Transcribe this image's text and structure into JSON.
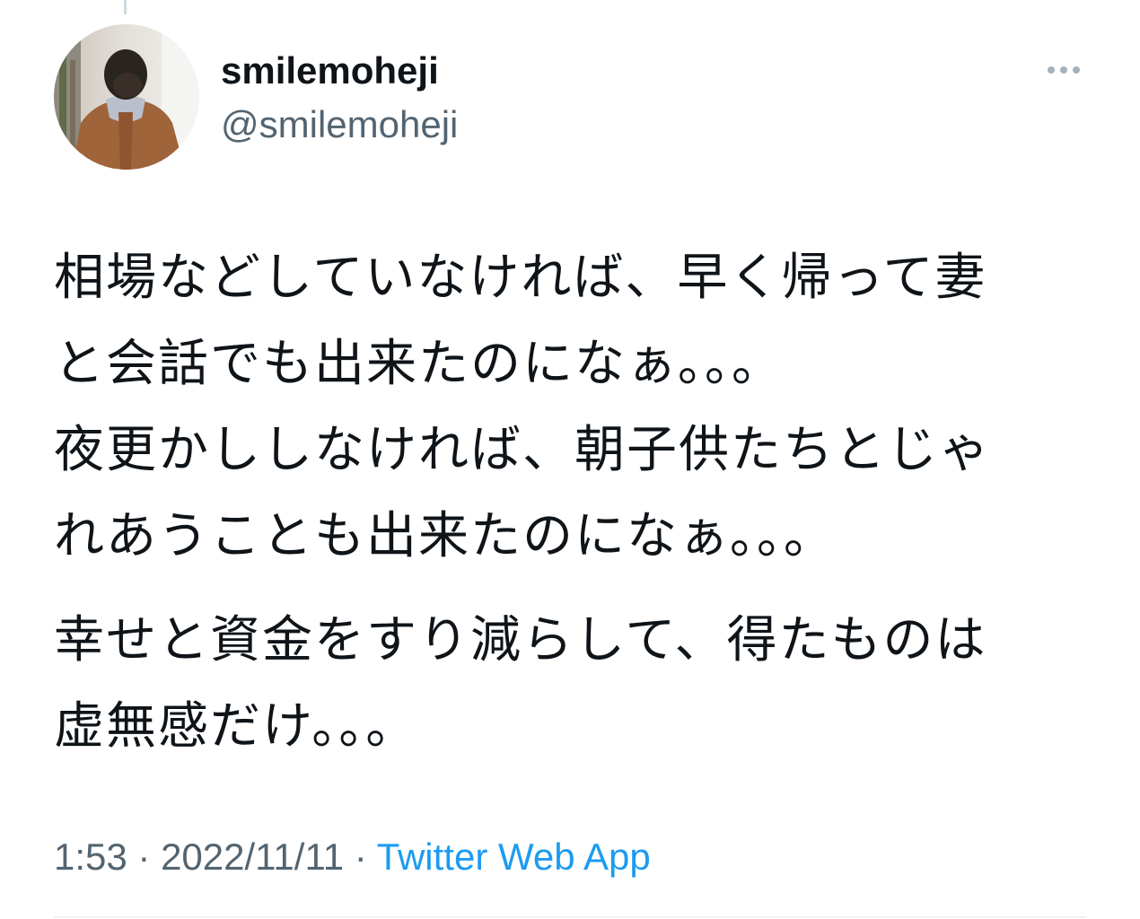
{
  "author": {
    "display_name": "smilemoheji",
    "handle": "@smilemoheji",
    "avatar_icon": "profile-photo"
  },
  "more_icon": "more-horizontal-icon",
  "tweet": {
    "paragraphs": [
      {
        "lines": [
          "相場などしていなければ、早く帰って妻",
          "と会話でも出来たのになぁ。。。",
          "夜更かししなければ、朝子供たちとじゃ",
          "れあうことも出来たのになぁ。。。"
        ]
      },
      {
        "lines": [
          "幸せと資金をすり減らして、得たものは",
          "虚無感だけ。。。"
        ]
      }
    ]
  },
  "meta": {
    "time": "1:53",
    "separator": " · ",
    "date": "2022/11/11",
    "source": "Twitter Web App"
  },
  "colors": {
    "text_primary": "#0f1419",
    "text_secondary": "#536471",
    "link": "#1d9bf0",
    "divider": "#eff3f4"
  }
}
